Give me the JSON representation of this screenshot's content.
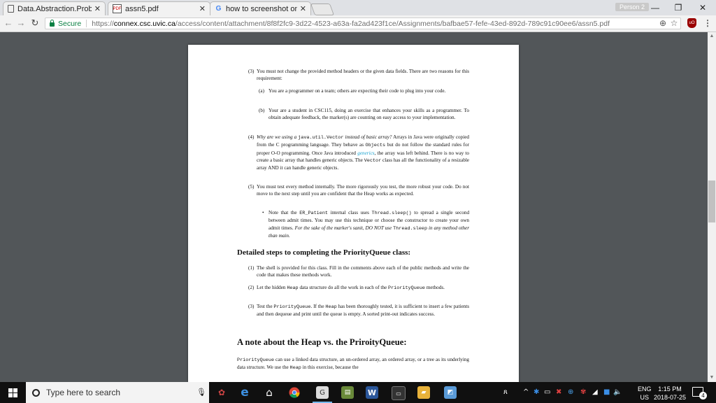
{
  "browser": {
    "tabs": [
      {
        "title": "Data.Abstraction.Problem",
        "icon": "document-icon",
        "active": false
      },
      {
        "title": "assn5.pdf",
        "icon": "pdf-icon",
        "active": true
      },
      {
        "title": "how to screenshot on wi",
        "icon": "google-icon",
        "active": false
      }
    ],
    "profile_label": "Person 2",
    "window_controls": {
      "minimize": "—",
      "restore": "❐",
      "close": "✕"
    },
    "address": {
      "security_label": "Secure",
      "url_scheme": "https://",
      "url_host": "connex.csc.uvic.ca",
      "url_path": "/access/content/attachment/8f8f2fc9-3d22-4523-a63a-fa2ad423f1ce/Assignments/bafbae57-fefe-43ed-892d-789c91c90ee6/assn5.pdf"
    },
    "extension_label": "uO"
  },
  "pdf": {
    "items": [
      {
        "num": "(3)",
        "text_a": "You must not change the provided method headers or the given data fields. There are two reasons for this requirement:"
      },
      {
        "num": "(a)",
        "text_a": "You are a programmer on a team; others are expecting their code to plug into your code."
      },
      {
        "num": "(b)",
        "text_a": "Your are a student in CSC115, doing an exercise that enhances your skills as a programmer. To obtain adequate feedback, the marker(s) are counting on easy access to your implementation."
      },
      {
        "num": "(4)",
        "italic_lead": "Why are we using a",
        "code1": "java.util.Vector",
        "italic_lead2": "instead of basic array?",
        "text_a": "Arrays in Java were originally copied from the C programming language. They behave as",
        "code2": "Objects",
        "text_b": "but do not follow the standard rules for proper O-O programming. Once Java introduced",
        "link": "generics",
        "text_c": ", the array was left behind. There is no way to create a basic array that handles generic objects. The",
        "code3": "Vector",
        "text_d": "class has all the functionality of a resizable array AND it can handle generic objects."
      },
      {
        "num": "(5)",
        "text_a": "You must test every method internally. The more rigorously you test, the more robust your code. Do not move to the next step until you are confident that the Heap works as expected."
      },
      {
        "num": "•",
        "text_a": "Note that the",
        "code1": "ER_Patient",
        "text_b": "internal class uses",
        "code2": "Thread.sleep()",
        "text_c": "to spread a single second between admit times. You may use this technique or choose the constructor to create your own admit times.",
        "italic_a": "For the sake of the marker's sanit, DO NOT use",
        "code3": "Thread.sleep",
        "italic_b": "in any method other than main."
      }
    ],
    "section1_title": "Detailed steps to completing the PriorityQueue class:",
    "steps": [
      {
        "num": "(1)",
        "text_a": "The shell is provided for this class. Fill in the comments above each of the public methods and write the code that makes these methods work."
      },
      {
        "num": "(2)",
        "text_a": "Let the hidden",
        "code1": "Heap",
        "text_b": "data structure do all the work in each of the",
        "code2": "PriorityQueue",
        "text_c": "methods."
      },
      {
        "num": "(3)",
        "text_a": "Test the",
        "code1": "PriorityQueue",
        "text_b": ". If the",
        "code2": "Heap",
        "text_c": "has been thoroughly tested, it is sufficient to insert a few patients and then dequeue and print until the queue is empty. A sorted print-out indicates success."
      }
    ],
    "section2_title": "A note about the Heap vs. the PriroityQueue:",
    "note": {
      "code1": "PriorityQueue",
      "text_a": "can use a linked data structure, an un-ordered array, an ordered array, or a tree as its underlying data structure. We use the",
      "code2": "Heap",
      "text_b": "in this exercise, because the"
    }
  },
  "taskbar": {
    "search_placeholder": "Type here to search",
    "lang_line1": "ENG",
    "lang_line2": "US",
    "time": "1:15 PM",
    "date": "2018-07-25",
    "notification_count": "4"
  }
}
